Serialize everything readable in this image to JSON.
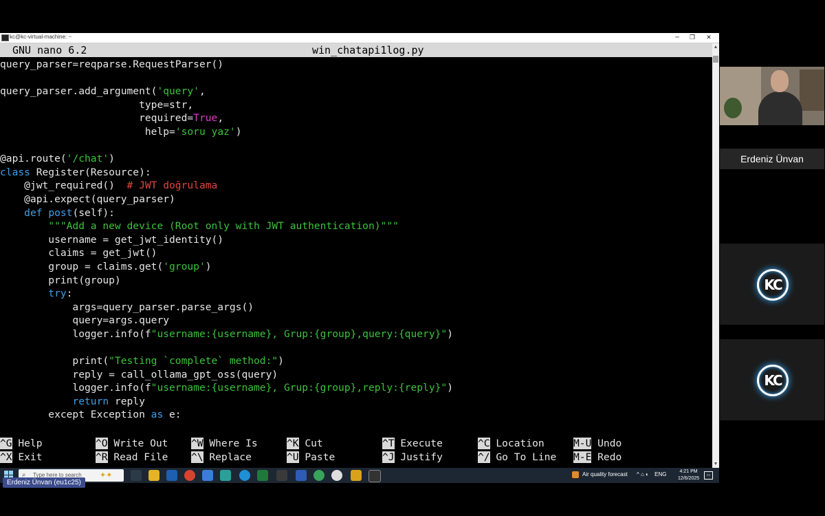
{
  "window": {
    "title": "kc@kc-virtual-machine: ~",
    "minimize": "─",
    "maximize": "❐",
    "close": "✕"
  },
  "nano": {
    "version": "GNU nano 6.2",
    "filename": "win_chatapi1log.py"
  },
  "code_lines": [
    [
      {
        "t": "query_parser=reqparse.RequestParser()",
        "c": ""
      }
    ],
    [],
    [
      {
        "t": "query_parser.add_argument(",
        "c": ""
      },
      {
        "t": "'query'",
        "c": "str"
      },
      {
        "t": ",",
        "c": ""
      }
    ],
    [
      {
        "t": "                       type=str,",
        "c": ""
      }
    ],
    [
      {
        "t": "                       required=",
        "c": ""
      },
      {
        "t": "True",
        "c": "tru"
      },
      {
        "t": ",",
        "c": ""
      }
    ],
    [
      {
        "t": "                        help=",
        "c": ""
      },
      {
        "t": "'soru yaz'",
        "c": "str"
      },
      {
        "t": ")",
        "c": ""
      }
    ],
    [],
    [
      {
        "t": "@api.route(",
        "c": ""
      },
      {
        "t": "'/chat'",
        "c": "str"
      },
      {
        "t": ")",
        "c": ""
      }
    ],
    [
      {
        "t": "class",
        "c": "kw"
      },
      {
        "t": " Register(Resource):",
        "c": ""
      }
    ],
    [
      {
        "t": "    @jwt_required()  ",
        "c": ""
      },
      {
        "t": "# JWT doğrulama",
        "c": "cmt"
      }
    ],
    [
      {
        "t": "    @api.expect(query_parser)",
        "c": ""
      }
    ],
    [
      {
        "t": "    ",
        "c": ""
      },
      {
        "t": "def",
        "c": "kw"
      },
      {
        "t": " ",
        "c": ""
      },
      {
        "t": "post",
        "c": "kw"
      },
      {
        "t": "(self):",
        "c": ""
      }
    ],
    [
      {
        "t": "        \"\"\"Add a new device (Root only with JWT authentication)\"\"\"",
        "c": "str"
      }
    ],
    [
      {
        "t": "        username = get_jwt_identity()",
        "c": ""
      }
    ],
    [
      {
        "t": "        claims = get_jwt()",
        "c": ""
      }
    ],
    [
      {
        "t": "        group = claims.get(",
        "c": ""
      },
      {
        "t": "'group'",
        "c": "str"
      },
      {
        "t": ")",
        "c": ""
      }
    ],
    [
      {
        "t": "        print(group)",
        "c": ""
      }
    ],
    [
      {
        "t": "        ",
        "c": ""
      },
      {
        "t": "try",
        "c": "kw"
      },
      {
        "t": ":",
        "c": ""
      }
    ],
    [
      {
        "t": "            args=query_parser.parse_args()",
        "c": ""
      }
    ],
    [
      {
        "t": "            query=args.query",
        "c": ""
      }
    ],
    [
      {
        "t": "            logger.info(f",
        "c": ""
      },
      {
        "t": "\"username:{username}, Grup:{group},query:{query}\"",
        "c": "str"
      },
      {
        "t": ")",
        "c": ""
      }
    ],
    [],
    [
      {
        "t": "            print(",
        "c": ""
      },
      {
        "t": "\"Testing `complete` method:\"",
        "c": "str"
      },
      {
        "t": ")",
        "c": ""
      }
    ],
    [
      {
        "t": "            reply = call_ollama_gpt_oss(query)",
        "c": ""
      }
    ],
    [
      {
        "t": "            logger.info(f",
        "c": ""
      },
      {
        "t": "\"username:{username}, Grup:{group},reply:{reply}\"",
        "c": "str"
      },
      {
        "t": ")",
        "c": ""
      }
    ],
    [
      {
        "t": "            ",
        "c": ""
      },
      {
        "t": "return",
        "c": "kw"
      },
      {
        "t": " reply",
        "c": ""
      }
    ],
    [
      {
        "t": "        except Exception ",
        "c": ""
      },
      {
        "t": "as",
        "c": "kw"
      },
      {
        "t": " e:",
        "c": ""
      }
    ]
  ],
  "shortcuts": [
    {
      "key": "^G",
      "label": "Help"
    },
    {
      "key": "^X",
      "label": "Exit"
    },
    {
      "key": "^O",
      "label": "Write Out"
    },
    {
      "key": "^R",
      "label": "Read File"
    },
    {
      "key": "^W",
      "label": "Where Is"
    },
    {
      "key": "^\\",
      "label": "Replace"
    },
    {
      "key": "^K",
      "label": "Cut"
    },
    {
      "key": "^U",
      "label": "Paste"
    },
    {
      "key": "^T",
      "label": "Execute"
    },
    {
      "key": "^J",
      "label": "Justify"
    },
    {
      "key": "^C",
      "label": "Location"
    },
    {
      "key": "^/",
      "label": "Go To Line"
    },
    {
      "key": "M-U",
      "label": "Undo"
    },
    {
      "key": "M-E",
      "label": "Redo"
    }
  ],
  "taskbar": {
    "search_placeholder": "Type here to search",
    "weather": "Air quality forecast",
    "language": "ENG",
    "time": "4:21 PM",
    "date": "12/6/2025",
    "tray_icons": "^ ⌂ ◐"
  },
  "participant_label": "Erdeniz Ünvan (eu1c25)",
  "video": {
    "speaker_name": "Erdeniz Ünvan",
    "tile_logo": "KC"
  }
}
